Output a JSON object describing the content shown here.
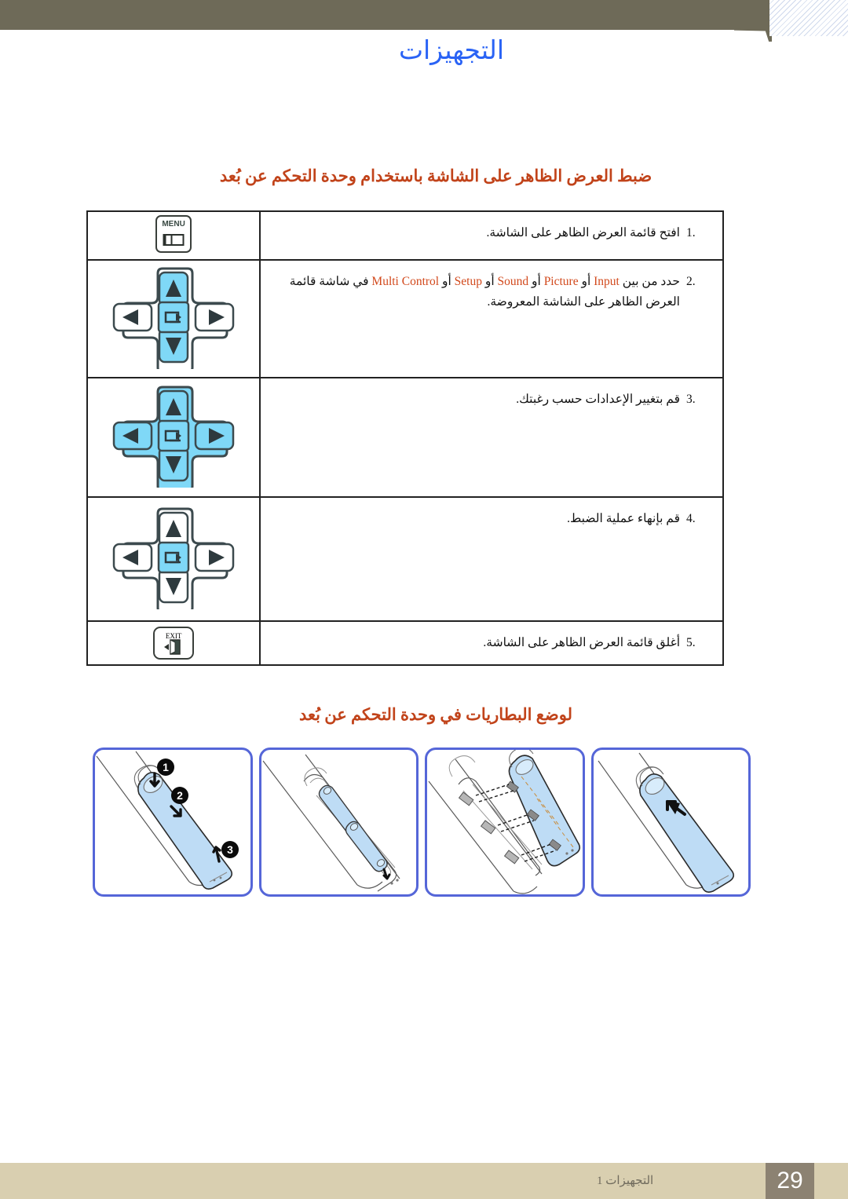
{
  "header": {
    "title": "التجهيزات"
  },
  "sections": {
    "osd": {
      "heading": "ضبط العرض الظاهر على الشاشة باستخدام وحدة التحكم عن بُعد",
      "steps": [
        {
          "number": "1.",
          "text": "افتح قائمة العرض الظاهر على الشاشة.",
          "icon": "menu-button-icon",
          "icon_label": "MENU"
        },
        {
          "number": "2.",
          "text_before": "حدد من بين",
          "options": [
            "Input",
            "Picture",
            "Sound",
            "Setup",
            "Multi Control"
          ],
          "separator": "أو",
          "text_after": "في شاشة قائمة العرض الظاهر على الشاشة المعروضة.",
          "icon": "dpad-up-down-enter-icon"
        },
        {
          "number": "3.",
          "text": "قم بتغيير الإعدادات حسب رغبتك.",
          "icon": "dpad-all-icon"
        },
        {
          "number": "4.",
          "text": "قم بإنهاء عملية الضبط.",
          "icon": "dpad-enter-icon"
        },
        {
          "number": "5.",
          "text": "أغلق قائمة العرض الظاهر على الشاشة.",
          "icon": "exit-button-icon",
          "icon_label": "EXIT"
        }
      ]
    },
    "battery": {
      "heading": "لوضع البطاريات في وحدة التحكم عن بُعد",
      "panels": [
        {
          "name": "remove-cover-panel",
          "callouts": [
            "1",
            "2",
            "3"
          ]
        },
        {
          "name": "insert-batteries-panel",
          "callouts": []
        },
        {
          "name": "align-cover-panel",
          "callouts": []
        },
        {
          "name": "slide-cover-panel",
          "callouts": []
        }
      ]
    }
  },
  "footer": {
    "section_label": "التجهيزات 1",
    "page_number": "29"
  },
  "colors": {
    "header_bar": "#6e6a58",
    "header_title": "#2a63f5",
    "heading": "#c1431a",
    "highlight_key": "#7fd8f7",
    "panel_border": "#5566d8",
    "footer_band": "#d9cfb0",
    "footer_page_box": "#8c8272"
  }
}
